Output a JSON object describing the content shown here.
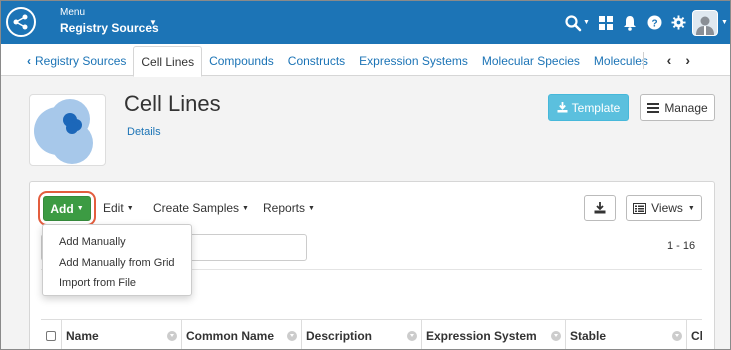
{
  "header": {
    "menu_label": "Menu",
    "project_name": "Registry Sources",
    "icons": [
      "logo-icon",
      "search-icon",
      "grid-icon",
      "bell-icon",
      "help-icon",
      "gear-icon",
      "user-avatar"
    ]
  },
  "subnav": {
    "back_label": "Registry Sources",
    "tabs": [
      "Cell Lines",
      "Compounds",
      "Constructs",
      "Expression Systems",
      "Molecular Species",
      "Molecules"
    ],
    "active_tab": "Cell Lines"
  },
  "page": {
    "title": "Cell Lines",
    "details_link": "Details",
    "template_button": "Template",
    "manage_button": "Manage"
  },
  "toolbar": {
    "add": "Add",
    "edit": "Edit",
    "create_samples": "Create Samples",
    "reports": "Reports",
    "views": "Views",
    "paging": "1 - 16"
  },
  "add_menu": {
    "items": [
      "Add Manually",
      "Add Manually from Grid",
      "Import from File"
    ]
  },
  "grid": {
    "columns": [
      "Name",
      "Common Name",
      "Description",
      "Expression System",
      "Stable",
      "Cl"
    ]
  },
  "colors": {
    "header_blue": "#1c74b6",
    "add_green": "#3c9b43",
    "template_blue": "#5bc0de",
    "highlight_ring": "#e35d3e"
  }
}
